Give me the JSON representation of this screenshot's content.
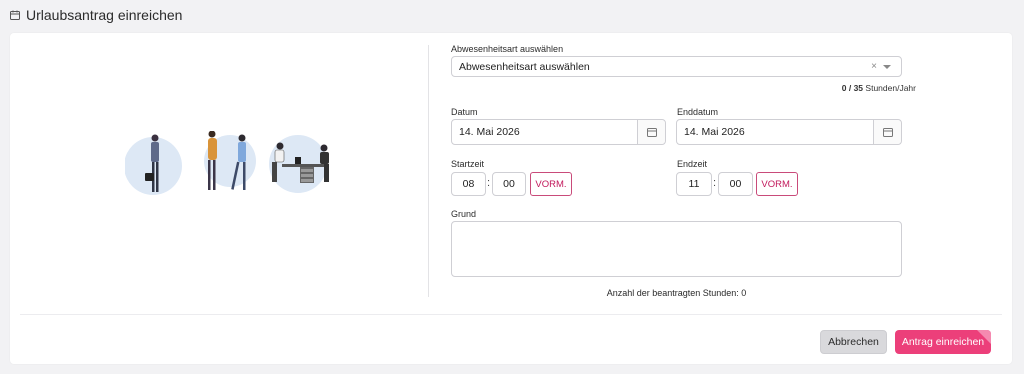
{
  "header": {
    "title": "Urlaubsantrag einreichen",
    "icon": "calendar-icon"
  },
  "form": {
    "absence_type": {
      "label": "Abwesenheitsart auswählen",
      "value": "Abwesenheitsart auswählen",
      "clear_glyph": "×"
    },
    "quota": {
      "used": "0 / 35",
      "unit": "Stunden/Jahr"
    },
    "start_date": {
      "label": "Datum",
      "value": "14. Mai 2026"
    },
    "end_date": {
      "label": "Enddatum",
      "value": "14. Mai 2026"
    },
    "start_time": {
      "label": "Startzeit",
      "hour": "08",
      "minute": "00",
      "separator": ":",
      "period": "VORM."
    },
    "end_time": {
      "label": "Endzeit",
      "hour": "11",
      "minute": "00",
      "separator": ":",
      "period": "VORM."
    },
    "reason": {
      "label": "Grund",
      "value": ""
    },
    "requested_hours": "Anzahl der beantragten Stunden: 0"
  },
  "actions": {
    "cancel": "Abbrechen",
    "submit": "Antrag einreichen"
  },
  "colors": {
    "accent": "#ec3f7a",
    "ampm_border": "#c94b7a",
    "background": "#f2f2f4"
  }
}
